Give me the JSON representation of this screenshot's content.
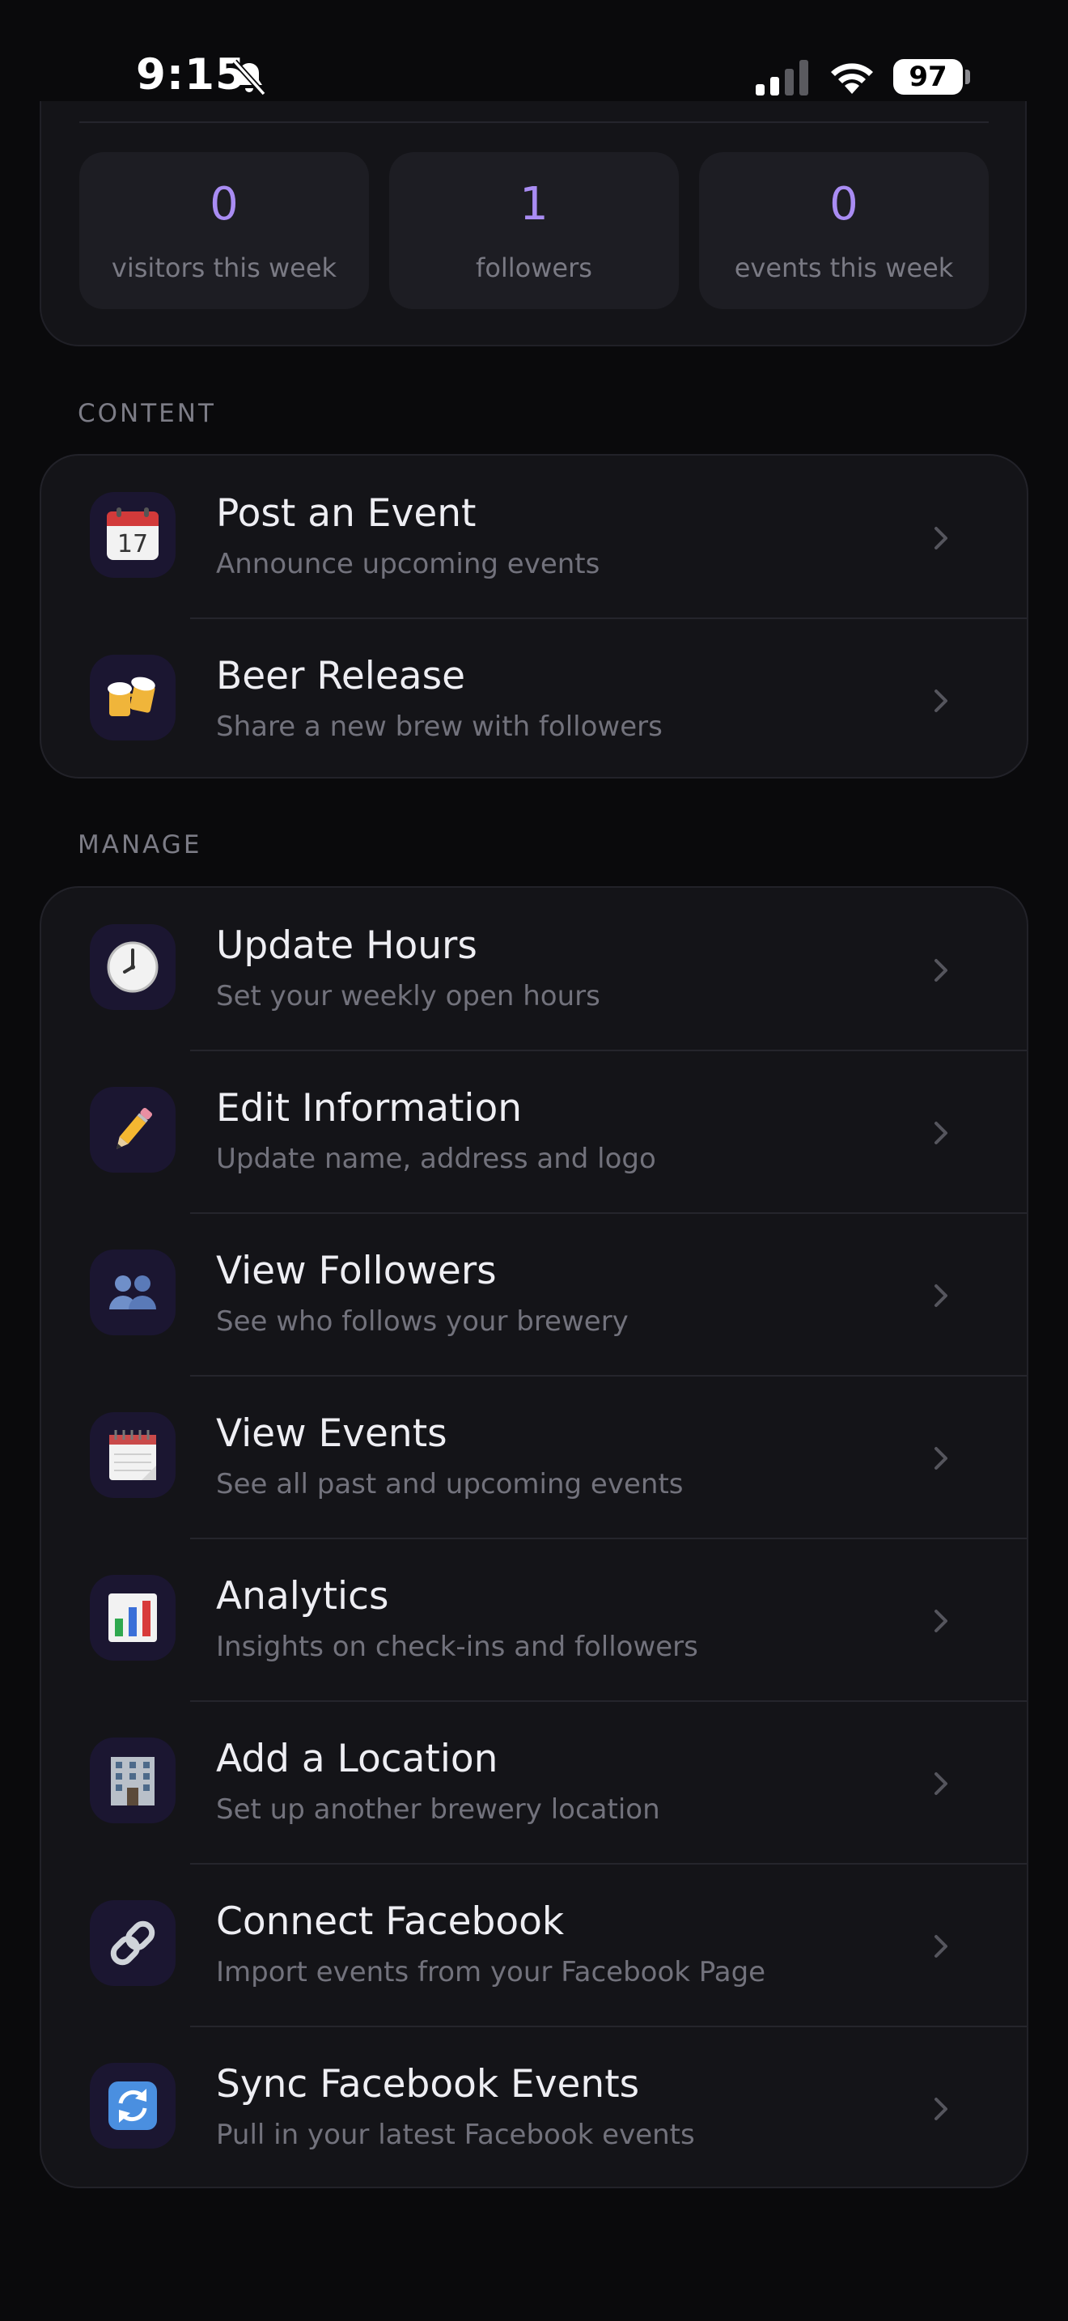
{
  "status_bar": {
    "time": "9:15",
    "battery": "97"
  },
  "stats": [
    {
      "value": "0",
      "label": "visitors this week"
    },
    {
      "value": "1",
      "label": "followers"
    },
    {
      "value": "0",
      "label": "events this week"
    }
  ],
  "sections": {
    "content": {
      "header": "CONTENT",
      "items": [
        {
          "icon": "calendar-icon",
          "title": "Post an Event",
          "subtitle": "Announce upcoming events"
        },
        {
          "icon": "beer-mugs-icon",
          "title": "Beer Release",
          "subtitle": "Share a new brew with followers"
        }
      ]
    },
    "manage": {
      "header": "MANAGE",
      "items": [
        {
          "icon": "clock-icon",
          "title": "Update Hours",
          "subtitle": "Set your weekly open hours"
        },
        {
          "icon": "pencil-icon",
          "title": "Edit Information",
          "subtitle": "Update name, address and logo"
        },
        {
          "icon": "people-icon",
          "title": "View Followers",
          "subtitle": "See who follows your brewery"
        },
        {
          "icon": "spiral-calendar-icon",
          "title": "View Events",
          "subtitle": "See all past and upcoming events"
        },
        {
          "icon": "bar-chart-icon",
          "title": "Analytics",
          "subtitle": "Insights on check-ins and followers"
        },
        {
          "icon": "office-building-icon",
          "title": "Add a Location",
          "subtitle": "Set up another brewery location"
        },
        {
          "icon": "link-icon",
          "title": "Connect Facebook",
          "subtitle": "Import events from your Facebook Page"
        },
        {
          "icon": "sync-icon",
          "title": "Sync Facebook Events",
          "subtitle": "Pull in your latest Facebook events"
        }
      ]
    }
  },
  "colors": {
    "background": "#0a0a0c",
    "card": "#141418",
    "accent": "#a98cf3",
    "icon_tile": "#1b1631"
  }
}
